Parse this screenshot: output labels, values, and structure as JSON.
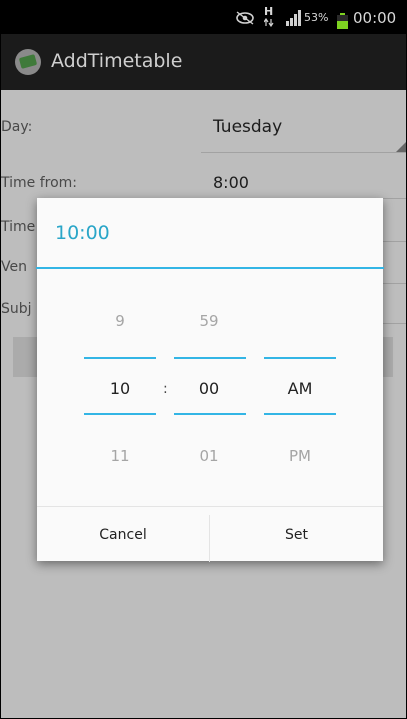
{
  "status_bar": {
    "network": "H",
    "battery": "53%",
    "time": "00:00"
  },
  "action_bar": {
    "title": "AddTimetable"
  },
  "form": {
    "day_label": "Day:",
    "day_value": "Tuesday",
    "time_from_label": "Time from:",
    "time_from_value": "8:00",
    "time_to_label": "Time",
    "venue_label": "Ven",
    "subject_label": "Subj"
  },
  "time_picker": {
    "title": "10:00",
    "hour": {
      "prev": "9",
      "current": "10",
      "next": "11"
    },
    "minute": {
      "prev": "59",
      "current": "00",
      "next": "01"
    },
    "ampm": {
      "current": "AM",
      "next": "PM"
    },
    "separator": ":",
    "cancel_label": "Cancel",
    "set_label": "Set"
  },
  "colors": {
    "accent": "#33b5e5",
    "title_accent": "#2aa6c8",
    "battery": "#7ed321"
  }
}
